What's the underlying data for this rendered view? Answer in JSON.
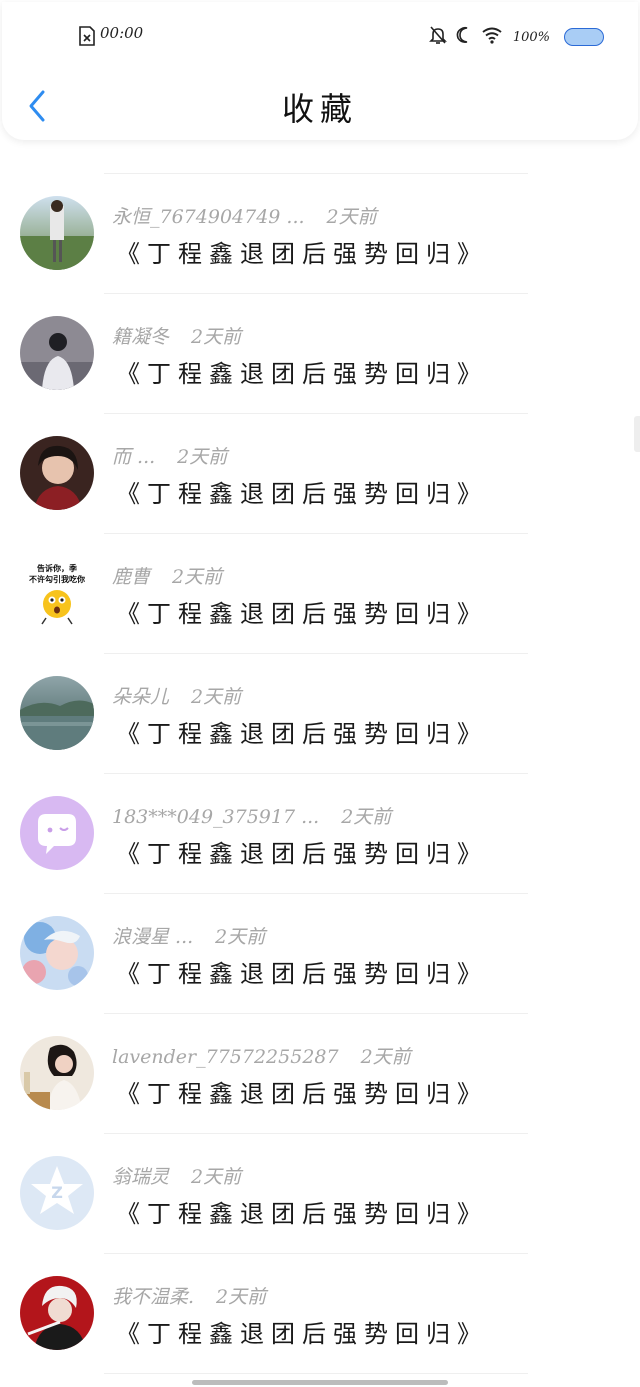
{
  "status_bar": {
    "time": "00:00",
    "battery": "100%"
  },
  "header": {
    "title": "收藏"
  },
  "items": [
    {
      "user": "永恒_7674904749 ...",
      "time": "2天前",
      "title": "《丁程鑫退团后强势回归》"
    },
    {
      "user": "籍凝冬",
      "time": "2天前",
      "title": "《丁程鑫退团后强势回归》"
    },
    {
      "user": "而 ...",
      "time": "2天前",
      "title": "《丁程鑫退团后强势回归》"
    },
    {
      "user": "鹿曹",
      "time": "2天前",
      "title": "《丁程鑫退团后强势回归》",
      "avatar_text_line1": "告诉你，季",
      "avatar_text_line2": "不许勾引我吃你"
    },
    {
      "user": "朵朵儿",
      "time": "2天前",
      "title": "《丁程鑫退团后强势回归》"
    },
    {
      "user": "183***049_375917 ...",
      "time": "2天前",
      "title": "《丁程鑫退团后强势回归》"
    },
    {
      "user": "浪漫星 ...",
      "time": "2天前",
      "title": "《丁程鑫退团后强势回归》"
    },
    {
      "user": "lavender_77572255287",
      "time": "2天前",
      "title": "《丁程鑫退团后强势回归》"
    },
    {
      "user": "翁瑞灵",
      "time": "2天前",
      "title": "《丁程鑫退团后强势回归》"
    },
    {
      "user": "我不温柔.",
      "time": "2天前",
      "title": "《丁程鑫退团后强势回归》"
    }
  ],
  "colors": {
    "accent": "#2e8cf0",
    "meta_text": "#a7a7a7",
    "title_text": "#1a1a1a",
    "battery_fill": "#a9cdf5"
  }
}
